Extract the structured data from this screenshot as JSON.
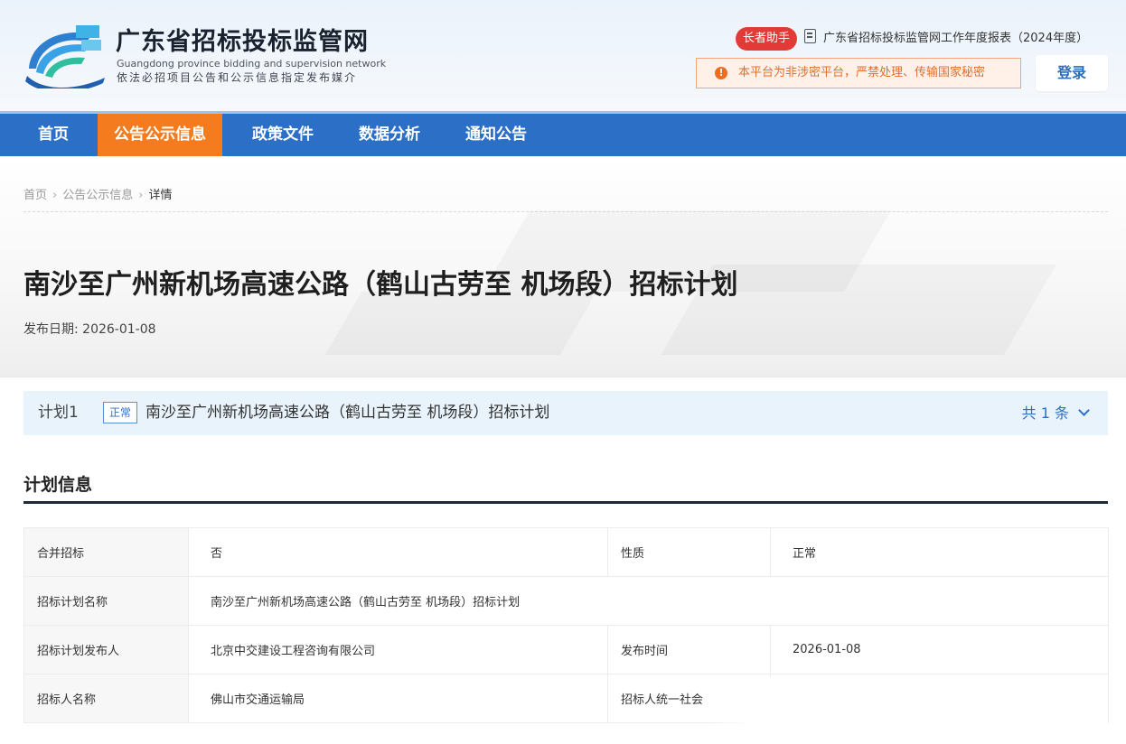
{
  "header": {
    "site_title": "广东省招标投标监管网",
    "site_title_en": "Guangdong province bidding and supervision network",
    "site_tagline": "依法必招项目公告和公示信息指定发布媒介",
    "elder_assistant": "长者助手",
    "annual_report_link": "广东省招标投标监管网工作年度报表（2024年度）",
    "warning_text": "本平台为非涉密平台，严禁处理、传输国家秘密",
    "warning_icon": "!",
    "login_label": "登录"
  },
  "nav": {
    "items": [
      {
        "label": "首页",
        "active": false
      },
      {
        "label": "公告公示信息",
        "active": true
      },
      {
        "label": "政策文件",
        "active": false
      },
      {
        "label": "数据分析",
        "active": false
      },
      {
        "label": "通知公告",
        "active": false
      }
    ]
  },
  "breadcrumb": {
    "items": [
      "首页",
      "公告公示信息",
      "详情"
    ],
    "separator": "›"
  },
  "page": {
    "title": "南沙至广州新机场高速公路（鹤山古劳至 机场段）招标计划",
    "publish_date": "发布日期: 2026-01-08"
  },
  "plan_bar": {
    "label": "计划1",
    "tag": "正常",
    "name": "南沙至广州新机场高速公路（鹤山古劳至 机场段）招标计划",
    "count": "共 1 条"
  },
  "section": {
    "title": "计划信息"
  },
  "info_table": {
    "rows": [
      [
        {
          "label": "合并招标",
          "value": "否"
        },
        {
          "label": "性质",
          "value": "正常"
        }
      ],
      [
        {
          "label": "招标计划名称",
          "value": "南沙至广州新机场高速公路（鹤山古劳至 机场段）招标计划"
        }
      ],
      [
        {
          "label": "招标计划发布人",
          "value": "北京中交建设工程咨询有限公司"
        },
        {
          "label": "发布时间",
          "value": "2026-01-08"
        }
      ],
      [
        {
          "label": "招标人名称",
          "value": "佛山市交通运输局"
        },
        {
          "label": "招标人统一社会",
          "value": ""
        }
      ]
    ]
  },
  "colors": {
    "nav_bg": "#2c6fc6",
    "nav_active": "#f47c1f",
    "accent_blue": "#2d6fc6",
    "elder_badge": "#e23b37",
    "warning": "#e26e2c"
  }
}
